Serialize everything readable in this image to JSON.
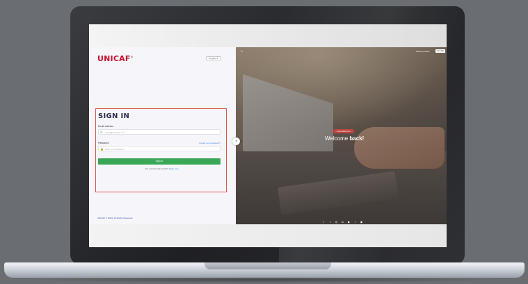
{
  "brand": {
    "logo_text": "UNICAF",
    "logo_mark": "®",
    "accent_color": "#c8102e"
  },
  "language_select": {
    "value": "English ▾"
  },
  "signin": {
    "title": "SIGN IN",
    "email_label": "Email address",
    "email_placeholder": "name@example.com",
    "password_label": "Password",
    "password_placeholder": "Enter your password",
    "forgot_link": "Forgot your password?",
    "button_label": "Sign in",
    "enrolled_prefix": "Not enrolled with Unicaf? ",
    "enrolled_link": "Apply now",
    "button_color": "#3aa757"
  },
  "footer": {
    "copyright": "UNICAF © 2024 | All Rights Reserved."
  },
  "hero": {
    "trouble_text": "Having trouble?",
    "get_help_label": "Get Help",
    "badge_text": "Good afternoon",
    "welcome_prefix": "Welcome ",
    "welcome_bold": "back!"
  },
  "icons": {
    "home": "⌂",
    "collapse": "‹",
    "mail": "✉",
    "lock": "🔒",
    "social": [
      "f",
      "t",
      "◎",
      "in",
      "▶",
      "♪",
      "◉"
    ]
  }
}
